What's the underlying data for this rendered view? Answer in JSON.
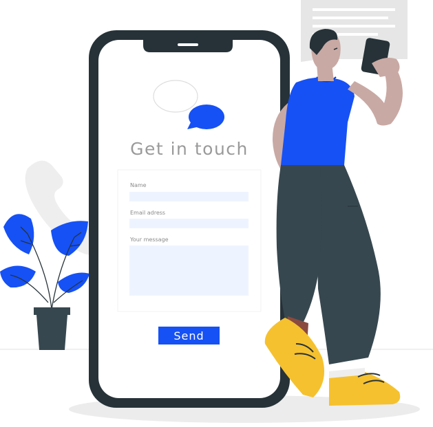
{
  "form": {
    "title": "Get in touch",
    "name_label": "Name",
    "email_label": "Email adress",
    "message_label": "Your message",
    "send_label": "Send"
  },
  "colors": {
    "accent": "#1651f5",
    "phone_frame": "#263238",
    "shirt": "#1651f5",
    "shoes": "#f5c12e",
    "pants": "#37474f",
    "skin": "#c9a9a4",
    "field_bg": "#eef4ff",
    "title_text": "#9a9a9a"
  },
  "icons": [
    "chat-bubble-outline-icon",
    "chat-bubble-filled-icon",
    "phone-handset-icon",
    "message-card-icon"
  ]
}
